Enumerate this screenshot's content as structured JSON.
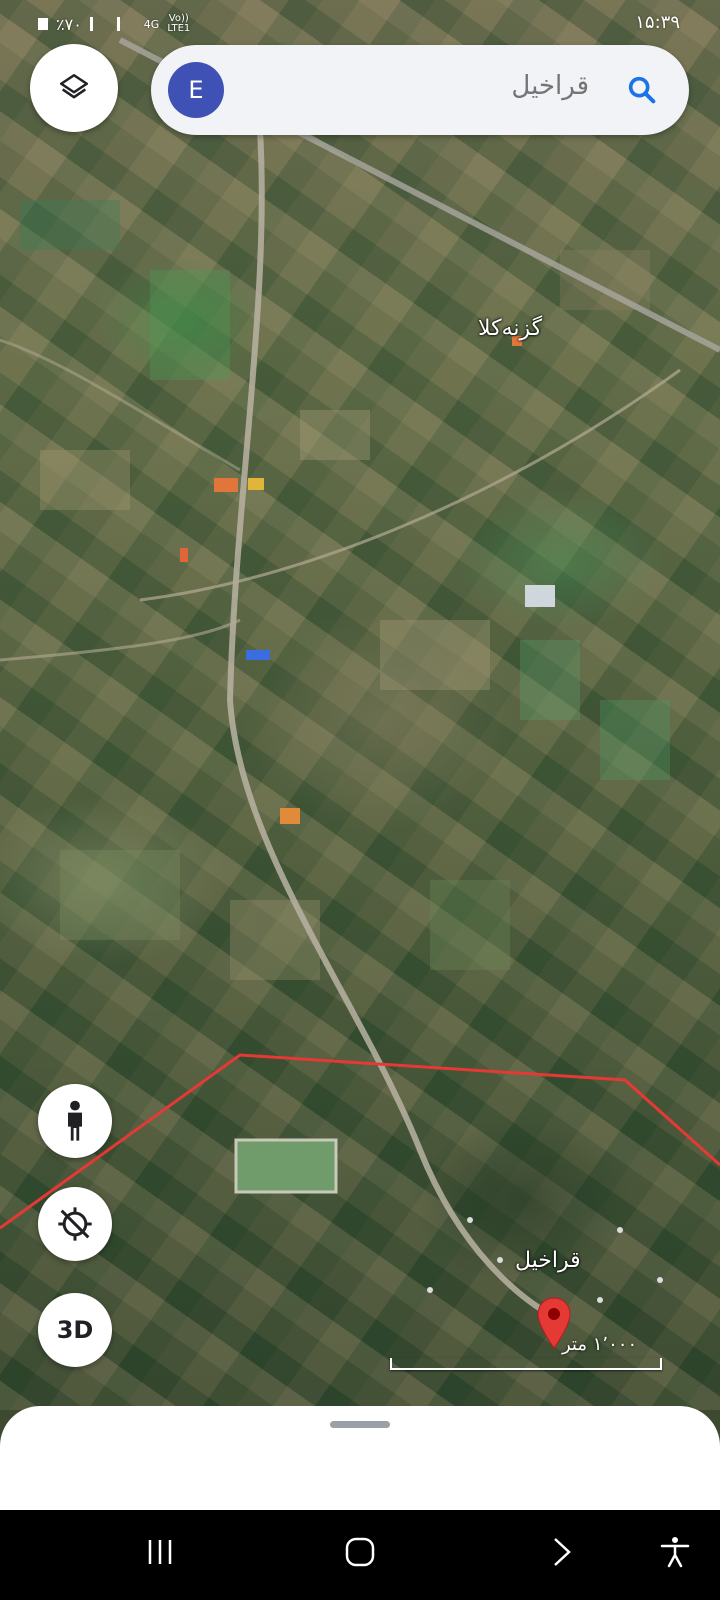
{
  "status_bar": {
    "battery": "٪۷۰",
    "network": "4G",
    "volte": "Vo))",
    "lte": "LTE1",
    "time": "۱۵:۳۹"
  },
  "search": {
    "avatar_initial": "E",
    "query": "قراخیل"
  },
  "map": {
    "labels": {
      "village_north": "گزنه‌کلا",
      "village_south": "قراخیل"
    },
    "boundary_color": "#e53935",
    "pin_color": "#e53935"
  },
  "scale": {
    "label": "۱٬۰۰۰ متر"
  },
  "buttons": {
    "three_d": "3D"
  },
  "icons": {
    "layers": "layers-icon",
    "search": "search-icon",
    "street_view": "pegman-icon",
    "location": "location-off-icon",
    "recents": "recents-icon",
    "home": "home-icon",
    "back": "back-icon",
    "accessibility": "accessibility-icon"
  }
}
